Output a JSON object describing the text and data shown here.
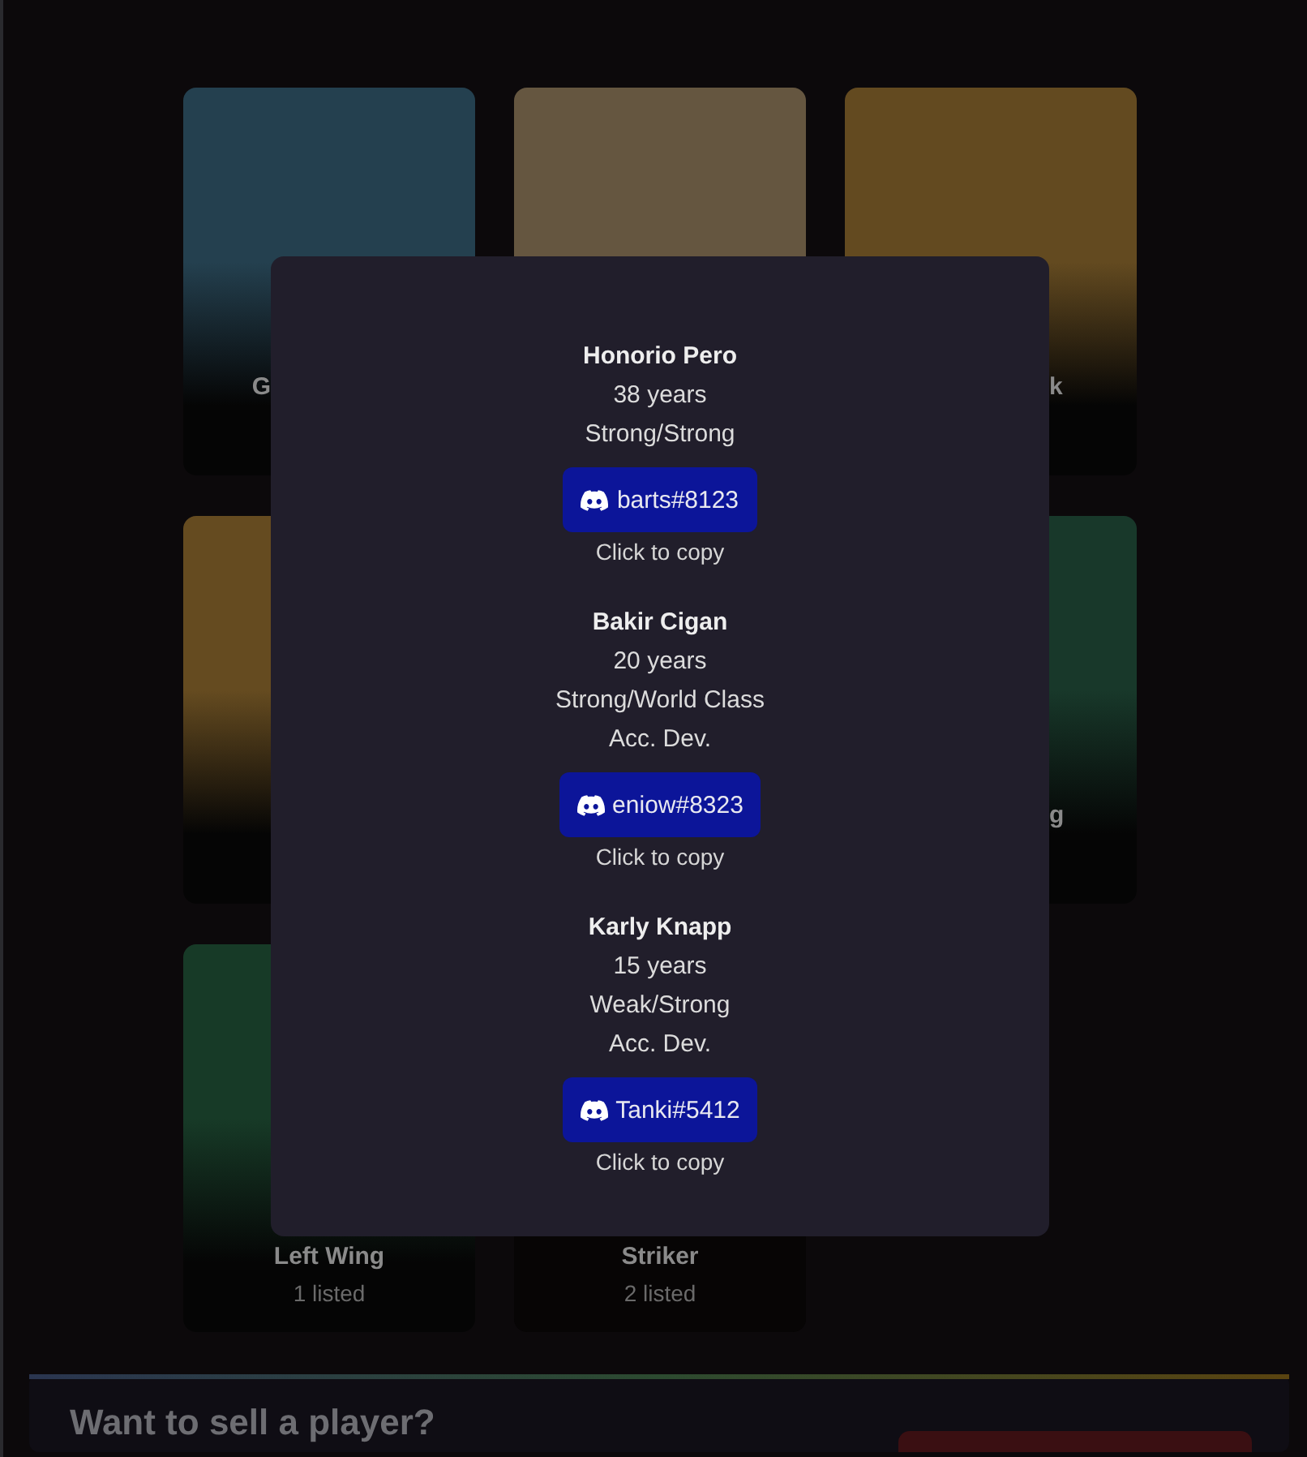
{
  "cards": [
    {
      "label": "G",
      "color": "#24404f"
    },
    {
      "color": "#655640"
    },
    {
      "label": "k",
      "color": "#634a20"
    },
    {
      "color": "#654b20"
    },
    {
      "label": "g",
      "color": "#18382a"
    },
    {
      "label": "Left Wing",
      "count": "1 listed",
      "color": "#173a27"
    },
    {
      "label": "Striker",
      "count": "2 listed"
    }
  ],
  "modal": {
    "players": [
      {
        "name": "Honorio Pero",
        "lines": [
          "38 years",
          "Strong/Strong"
        ],
        "handle": "barts#8123",
        "hint": "Click to copy"
      },
      {
        "name": "Bakir Cigan",
        "lines": [
          "20 years",
          "Strong/World Class",
          "Acc. Dev."
        ],
        "handle": "eniow#8323",
        "hint": "Click to copy"
      },
      {
        "name": "Karly Knapp",
        "lines": [
          "15 years",
          "Weak/Strong",
          "Acc. Dev."
        ],
        "handle": "Tanki#5412",
        "hint": "Click to copy"
      }
    ]
  },
  "banner": {
    "title": "Want to sell a player?"
  }
}
